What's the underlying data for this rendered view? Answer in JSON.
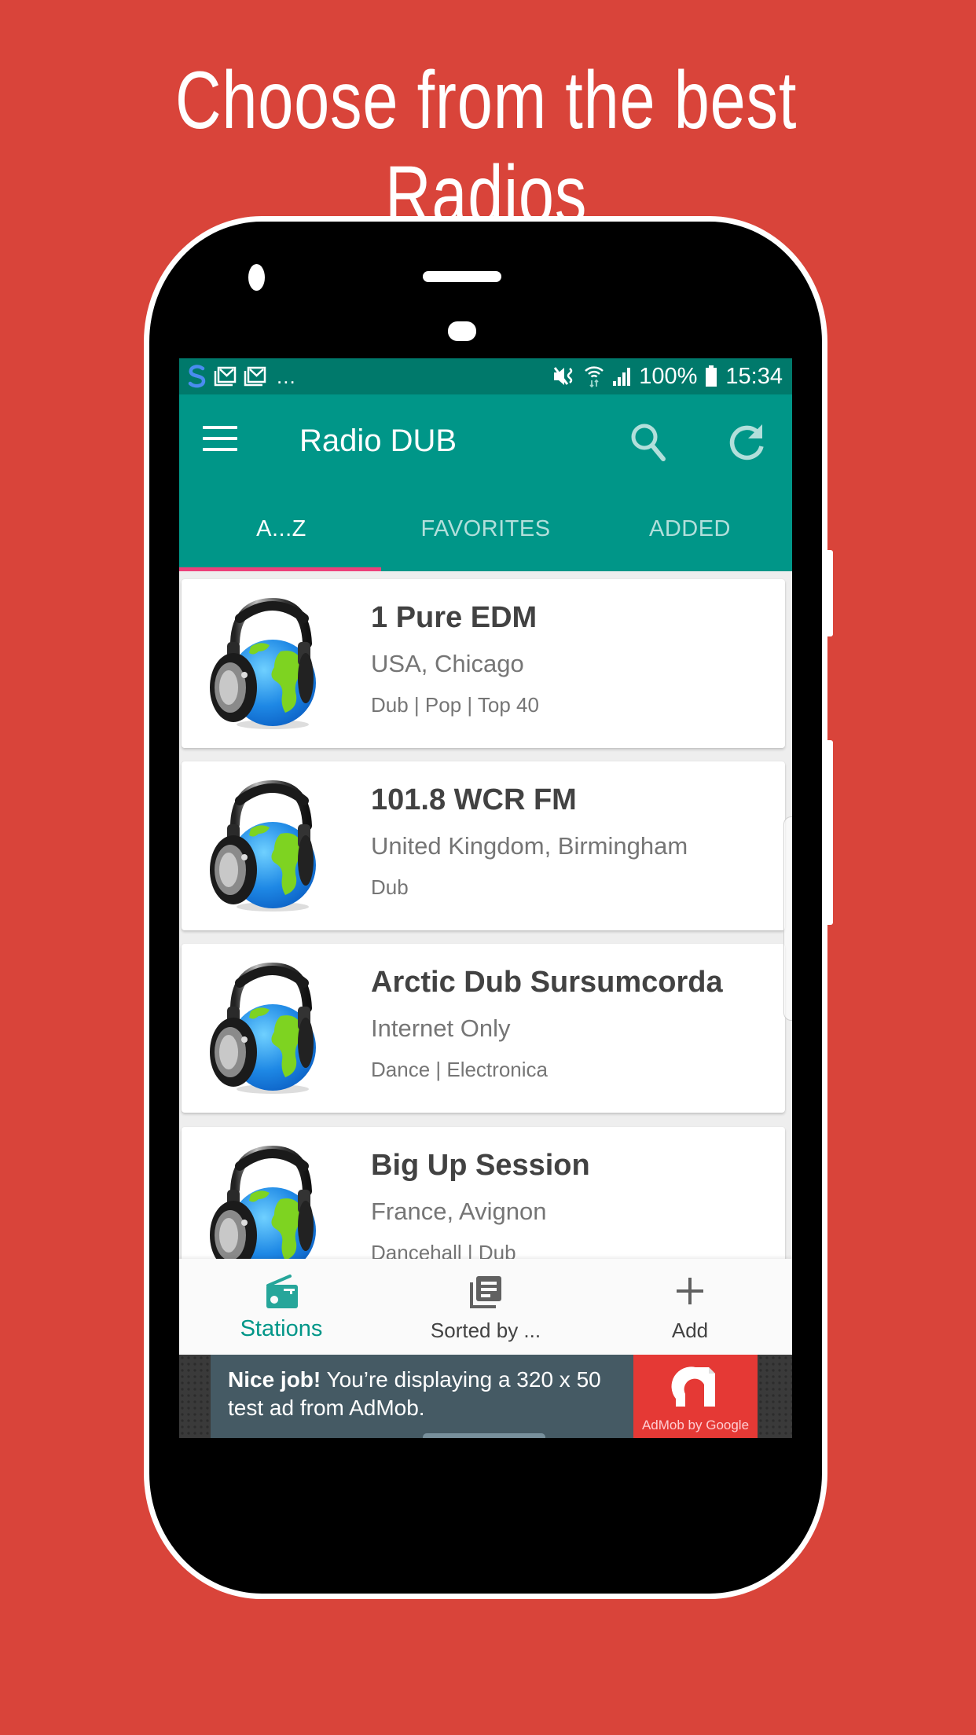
{
  "headline": "Choose from the best Radios",
  "colors": {
    "background": "#D9443A",
    "status_bar": "#00796B",
    "primary": "#009688",
    "tab_indicator": "#EC407A",
    "tab_inactive_text": "#B2DFDB",
    "ad_body": "#455A64",
    "ad_logo": "#E53935"
  },
  "status_bar": {
    "left_icons": [
      "s-app-icon",
      "gmail-icon",
      "gmail-icon",
      "more-notifications-dots"
    ],
    "more": "...",
    "right_icons": [
      "vibrate-mute-icon",
      "wifi-icon",
      "signal-icon",
      "battery-icon"
    ],
    "battery": "100%",
    "time": "15:34"
  },
  "toolbar": {
    "menu_icon": "hamburger-menu-icon",
    "title": "Radio DUB",
    "search_icon": "search-icon",
    "refresh_icon": "refresh-icon"
  },
  "tabs": [
    {
      "label": "A...Z",
      "active": true
    },
    {
      "label": "FAVORITES",
      "active": false
    },
    {
      "label": "ADDED",
      "active": false
    }
  ],
  "stations": [
    {
      "name": "1 Pure EDM",
      "location": "USA, Chicago",
      "genres": "Dub | Pop | Top 40",
      "icon": "headphones-globe-icon"
    },
    {
      "name": "101.8 WCR FM",
      "location": "United Kingdom, Birmingham",
      "genres": "Dub",
      "icon": "headphones-globe-icon"
    },
    {
      "name": "Arctic Dub Sursumcorda",
      "location": "Internet Only",
      "genres": "Dance | Electronica",
      "icon": "headphones-globe-icon"
    },
    {
      "name": "Big Up Session",
      "location": "France, Avignon",
      "genres": "Dancehall | Dub",
      "icon": "headphones-globe-icon"
    }
  ],
  "bottom_nav": [
    {
      "label": "Stations",
      "icon": "radio-icon",
      "active": true
    },
    {
      "label": "Sorted by ...",
      "icon": "library-books-icon",
      "active": false
    },
    {
      "label": "Add",
      "icon": "plus-icon",
      "active": false
    }
  ],
  "ad": {
    "bold": "Nice job!",
    "text": " You’re displaying a 320 x 50 test ad from AdMob.",
    "logo_text": "AdMob by Google"
  }
}
